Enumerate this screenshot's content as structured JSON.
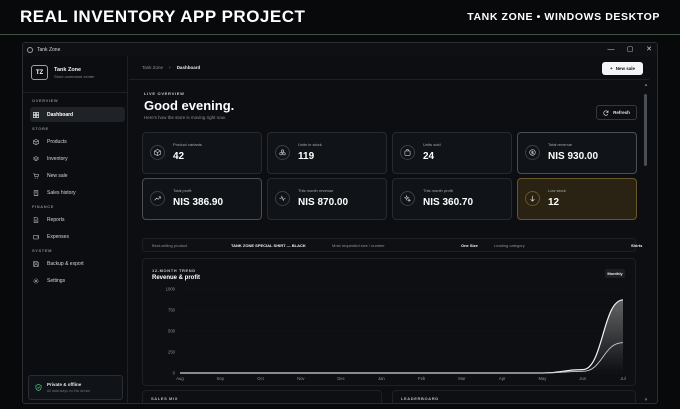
{
  "banner": {
    "title": "REAL INVENTORY APP PROJECT",
    "subtitle": "TANK ZONE • WINDOWS DESKTOP"
  },
  "window": {
    "title": "Tank Zone",
    "controls": [
      "minimize",
      "maximize",
      "close"
    ]
  },
  "sidebar": {
    "logo": "TZ",
    "brand_name": "Tank Zone",
    "brand_tagline": "Store command center",
    "sections": [
      {
        "label": "OVERVIEW",
        "items": [
          {
            "label": "Dashboard",
            "icon": "grid-icon",
            "active": true
          }
        ]
      },
      {
        "label": "STORE",
        "items": [
          {
            "label": "Products",
            "icon": "box-icon"
          },
          {
            "label": "Inventory",
            "icon": "layers-icon"
          },
          {
            "label": "New sale",
            "icon": "cart-icon"
          },
          {
            "label": "Sales history",
            "icon": "receipt-icon"
          }
        ]
      },
      {
        "label": "FINANCE",
        "items": [
          {
            "label": "Reports",
            "icon": "file-icon"
          },
          {
            "label": "Expenses",
            "icon": "wallet-icon"
          }
        ]
      },
      {
        "label": "SYSTEM",
        "items": [
          {
            "label": "Backup & export",
            "icon": "save-icon"
          },
          {
            "label": "Settings",
            "icon": "gear-icon"
          }
        ]
      }
    ],
    "status": {
      "title": "Private & offline",
      "subtitle": "All data stays on this device"
    }
  },
  "topbar": {
    "breadcrumb": [
      "Tank Zone",
      "Dashboard"
    ],
    "new_sale_label": "New sale"
  },
  "header": {
    "kicker": "LIVE OVERVIEW",
    "greeting": "Good evening.",
    "subtitle": "Here's how the store is moving right now.",
    "refresh_label": "Refresh"
  },
  "stats": [
    {
      "label": "Product variants",
      "value": "42",
      "icon": "cube-icon"
    },
    {
      "label": "Units in stock",
      "value": "119",
      "icon": "stack-icon"
    },
    {
      "label": "Units sold",
      "value": "24",
      "icon": "bag-icon"
    },
    {
      "label": "Total revenue",
      "value": "NIS 930.00",
      "icon": "coin-icon"
    },
    {
      "label": "Total profit",
      "value": "NIS 386.90",
      "icon": "trend-icon"
    },
    {
      "label": "This month revenue",
      "value": "NIS 870.00",
      "icon": "pulse-icon"
    },
    {
      "label": "This month profit",
      "value": "NIS 360.70",
      "icon": "sparkle-icon"
    },
    {
      "label": "Low stock",
      "value": "12",
      "icon": "arrow-down-icon"
    }
  ],
  "highlights": {
    "best_label": "Best-selling product",
    "best_value": "TANK ZONE SPECIAL SHIRT — BLACK",
    "size_label": "Most requested size / number",
    "size_value": "One Size",
    "category_label": "Leading category",
    "category_value": "Shirts"
  },
  "chart": {
    "kicker": "12-MONTH TREND",
    "title": "Revenue & profit",
    "toggle": "Monthly"
  },
  "chart_data": {
    "type": "area",
    "categories": [
      "Aug",
      "Sep",
      "Oct",
      "Nov",
      "Dec",
      "Jan",
      "Feb",
      "Mar",
      "Apr",
      "May",
      "Jun",
      "Jul"
    ],
    "series": [
      {
        "values": [
          0,
          0,
          0,
          0,
          0,
          0,
          0,
          0,
          0,
          0,
          40,
          870
        ],
        "color": "#f2f3f4"
      },
      {
        "values": [
          0,
          0,
          0,
          0,
          0,
          0,
          0,
          0,
          0,
          0,
          20,
          360.7
        ],
        "color": "#c9cdd1"
      }
    ],
    "ylim": [
      0,
      1000
    ],
    "yticks": [
      0,
      250,
      500,
      750,
      1000
    ],
    "grid": true
  },
  "bottom": {
    "left_label": "SALES MIX",
    "right_label": "LEADERBOARD"
  }
}
